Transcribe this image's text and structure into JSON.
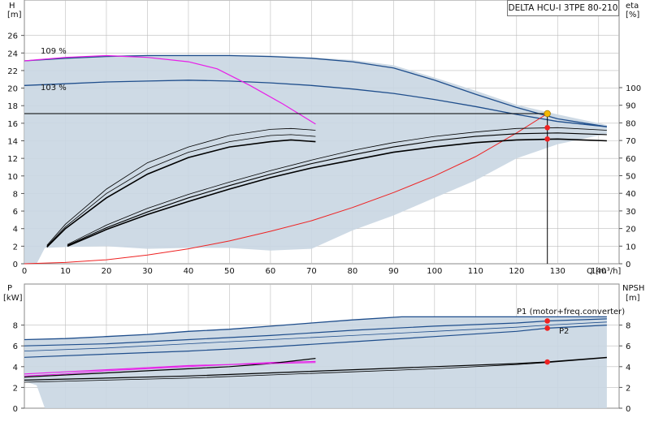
{
  "title": "DELTA HCU-I 3TPE 80-210",
  "colors": {
    "grid": "#bdbdbd",
    "envelope": "#c9d6e2",
    "blue": "#1f4e8c",
    "magenta": "#e81ee8",
    "red": "#ee2222",
    "black": "#000000",
    "dut": "#f5b800"
  },
  "chart_data": [
    {
      "type": "line",
      "title": "DELTA HCU-I 3TPE 80-210",
      "xlabel": "Q [m³/h]",
      "ylabel": "H\n[m]",
      "y2label": "eta\n[%]",
      "xlim": [
        0,
        145
      ],
      "ylim": [
        0,
        28
      ],
      "y2lim": [
        0,
        100
      ],
      "grid": true,
      "x_ticks": [
        "0",
        "10",
        "20",
        "30",
        "40",
        "50",
        "60",
        "70",
        "80",
        "90",
        "100",
        "110",
        "120",
        "130",
        "140"
      ],
      "y_ticks": [
        "0",
        "2",
        "4",
        "6",
        "8",
        "10",
        "12",
        "14",
        "16",
        "18",
        "20",
        "22",
        "24",
        "26"
      ],
      "y2_ticks": [
        "0",
        "10",
        "20",
        "30",
        "40",
        "50",
        "60",
        "70",
        "80",
        "90",
        "100"
      ],
      "annotations": [
        "109 %",
        "103 %"
      ],
      "duty_point": {
        "x": 127.5,
        "y": 17.1
      },
      "series": [
        {
          "role": "envelope",
          "x": [
            0,
            3,
            10,
            20,
            30,
            40,
            50,
            60,
            70,
            80,
            90,
            100,
            110,
            120,
            130,
            142
          ],
          "y": [
            23.1,
            23.3,
            23.5,
            23.7,
            23.8,
            23.8,
            23.8,
            23.7,
            23.5,
            23.2,
            22.6,
            21.2,
            19.7,
            18.1,
            17.0,
            15.8
          ]
        },
        {
          "role": "envelope-bottom",
          "x": [
            0,
            3,
            5,
            10,
            20,
            30,
            40,
            50,
            60,
            70,
            80,
            90,
            100,
            110,
            120,
            130,
            142
          ],
          "y": [
            0,
            0,
            1.8,
            1.9,
            2.0,
            1.7,
            1.8,
            1.8,
            1.5,
            1.7,
            3.8,
            5.5,
            7.5,
            9.5,
            12.0,
            13.6,
            14.8
          ]
        },
        {
          "name": "109 %",
          "x": [
            0,
            10,
            20,
            30,
            40,
            50,
            60,
            70,
            80,
            90,
            100,
            110,
            120,
            130,
            142
          ],
          "y": [
            23.1,
            23.4,
            23.6,
            23.7,
            23.7,
            23.7,
            23.6,
            23.4,
            23.0,
            22.3,
            20.9,
            19.3,
            17.8,
            16.5,
            15.6
          ]
        },
        {
          "name": "103 %",
          "x": [
            0,
            10,
            20,
            30,
            40,
            50,
            60,
            70,
            80,
            90,
            100,
            110,
            120,
            130,
            142
          ],
          "y": [
            20.3,
            20.5,
            20.7,
            20.8,
            20.9,
            20.8,
            20.6,
            20.3,
            19.9,
            19.4,
            18.7,
            17.9,
            17.0,
            16.2,
            15.6
          ]
        },
        {
          "role": "max-curve-magenta",
          "x": [
            0,
            10,
            20,
            25,
            30,
            40,
            47,
            55,
            63,
            71
          ],
          "y": [
            23.1,
            23.5,
            23.7,
            23.6,
            23.5,
            23.0,
            22.2,
            20.3,
            18.2,
            15.9
          ]
        },
        {
          "role": "system-curve",
          "x": [
            0,
            10,
            20,
            30,
            40,
            50,
            60,
            70,
            80,
            90,
            100,
            110,
            120,
            127.5
          ],
          "y": [
            0,
            0.15,
            0.45,
            1.0,
            1.7,
            2.6,
            3.7,
            4.9,
            6.4,
            8.1,
            10.0,
            12.2,
            14.9,
            17.1
          ]
        },
        {
          "role": "duty-line-horizontal",
          "x": [
            0,
            127.5
          ],
          "y": [
            17.1,
            17.1
          ]
        },
        {
          "role": "duty-line-vertical",
          "x": [
            127.5,
            127.5
          ],
          "y": [
            0,
            17.1
          ]
        },
        {
          "role": "eta-upper-low",
          "x": [
            5.5,
            10,
            20,
            30,
            40,
            50,
            60,
            65,
            71
          ],
          "y": [
            2.1,
            4.5,
            8.5,
            11.5,
            13.3,
            14.6,
            15.3,
            15.4,
            15.2
          ]
        },
        {
          "role": "eta-lower-low",
          "x": [
            5.5,
            10,
            20,
            30,
            40,
            50,
            60,
            65,
            71
          ],
          "y": [
            1.9,
            4.0,
            7.5,
            10.2,
            12.1,
            13.3,
            13.9,
            14.1,
            13.9
          ]
        },
        {
          "role": "eta-upper-high",
          "x": [
            10.5,
            20,
            30,
            40,
            50,
            60,
            70,
            80,
            90,
            100,
            110,
            120,
            130,
            142
          ],
          "y": [
            2.2,
            4.4,
            6.3,
            7.9,
            9.3,
            10.6,
            11.8,
            12.9,
            13.8,
            14.5,
            15.0,
            15.4,
            15.5,
            15.2
          ]
        },
        {
          "role": "eta-lower-high",
          "x": [
            10.5,
            20,
            30,
            40,
            50,
            60,
            70,
            80,
            90,
            100,
            110,
            120,
            130,
            142
          ],
          "y": [
            2.0,
            3.9,
            5.6,
            7.1,
            8.5,
            9.8,
            10.9,
            11.8,
            12.7,
            13.3,
            13.8,
            14.1,
            14.2,
            14.0
          ]
        }
      ],
      "markers": [
        {
          "x": 127.5,
          "y": 15.5
        },
        {
          "x": 127.5,
          "y": 14.2
        }
      ]
    },
    {
      "type": "line",
      "xlabel": "",
      "ylabel": "P\n[kW]",
      "y2label": "NPSH\n[m]",
      "xlim": [
        0,
        145
      ],
      "ylim": [
        0,
        10
      ],
      "y2lim": [
        0,
        10
      ],
      "grid": true,
      "y_ticks": [
        "0",
        "2",
        "4",
        "6",
        "8"
      ],
      "y2_ticks": [
        "0",
        "2",
        "4",
        "6",
        "8"
      ],
      "legend": [
        "P1 (motor+freq.converter)",
        "P2"
      ],
      "series": [
        {
          "role": "envelope",
          "x": [
            0,
            10,
            20,
            30,
            40,
            50,
            60,
            70,
            80,
            92,
            100,
            110,
            120,
            130,
            142
          ],
          "y": [
            6.6,
            6.7,
            6.9,
            7.1,
            7.4,
            7.6,
            7.9,
            8.2,
            8.5,
            8.8,
            8.8,
            8.8,
            8.8,
            8.8,
            8.8
          ]
        },
        {
          "role": "envelope-bottom",
          "x": [
            0,
            3,
            5,
            10,
            20,
            30,
            40,
            50,
            60,
            70,
            80,
            90,
            100,
            110,
            120,
            130,
            142
          ],
          "y": [
            2.6,
            2.2,
            0,
            0,
            0,
            0,
            0,
            0,
            0,
            0,
            0,
            0,
            0,
            0,
            0,
            0,
            0
          ]
        },
        {
          "name": "P1 (motor+freq.converter)",
          "x": [
            0,
            20,
            40,
            60,
            80,
            100,
            120,
            127.5,
            142
          ],
          "y": [
            6.0,
            6.2,
            6.6,
            7.0,
            7.5,
            7.9,
            8.2,
            8.4,
            8.6
          ]
        },
        {
          "role": "P1-mid",
          "x": [
            0,
            20,
            40,
            60,
            80,
            100,
            120,
            127.5,
            142
          ],
          "y": [
            5.5,
            5.8,
            6.2,
            6.6,
            7.0,
            7.4,
            7.8,
            8.0,
            8.3
          ]
        },
        {
          "name": "P2",
          "x": [
            0,
            20,
            40,
            60,
            80,
            100,
            120,
            127.5,
            142
          ],
          "y": [
            4.9,
            5.2,
            5.5,
            5.9,
            6.4,
            6.9,
            7.4,
            7.7,
            8.0
          ]
        },
        {
          "role": "P1-low",
          "x": [
            0,
            10,
            20,
            30,
            40,
            50,
            60,
            71
          ],
          "y": [
            3.3,
            3.5,
            3.7,
            3.9,
            4.1,
            4.2,
            4.4,
            4.5
          ]
        },
        {
          "role": "P2-low",
          "x": [
            0,
            10,
            20,
            30,
            40,
            50,
            60,
            71
          ],
          "y": [
            3.0,
            3.2,
            3.4,
            3.6,
            3.8,
            4.0,
            4.3,
            4.8
          ]
        },
        {
          "role": "npsh-1",
          "x": [
            0,
            20,
            40,
            60,
            80,
            100,
            120,
            127.5,
            142
          ],
          "y": [
            2.7,
            2.9,
            3.1,
            3.4,
            3.7,
            4.0,
            4.3,
            4.45,
            4.9
          ]
        },
        {
          "role": "npsh-2",
          "x": [
            0,
            20,
            40,
            60,
            80,
            100,
            120,
            127.5,
            142
          ],
          "y": [
            2.5,
            2.7,
            2.9,
            3.2,
            3.5,
            3.8,
            4.2,
            4.4,
            4.85
          ]
        }
      ],
      "markers": [
        {
          "x": 127.5,
          "y": 8.4
        },
        {
          "x": 127.5,
          "y": 7.7
        },
        {
          "x": 127.5,
          "y": 4.45
        }
      ]
    }
  ]
}
